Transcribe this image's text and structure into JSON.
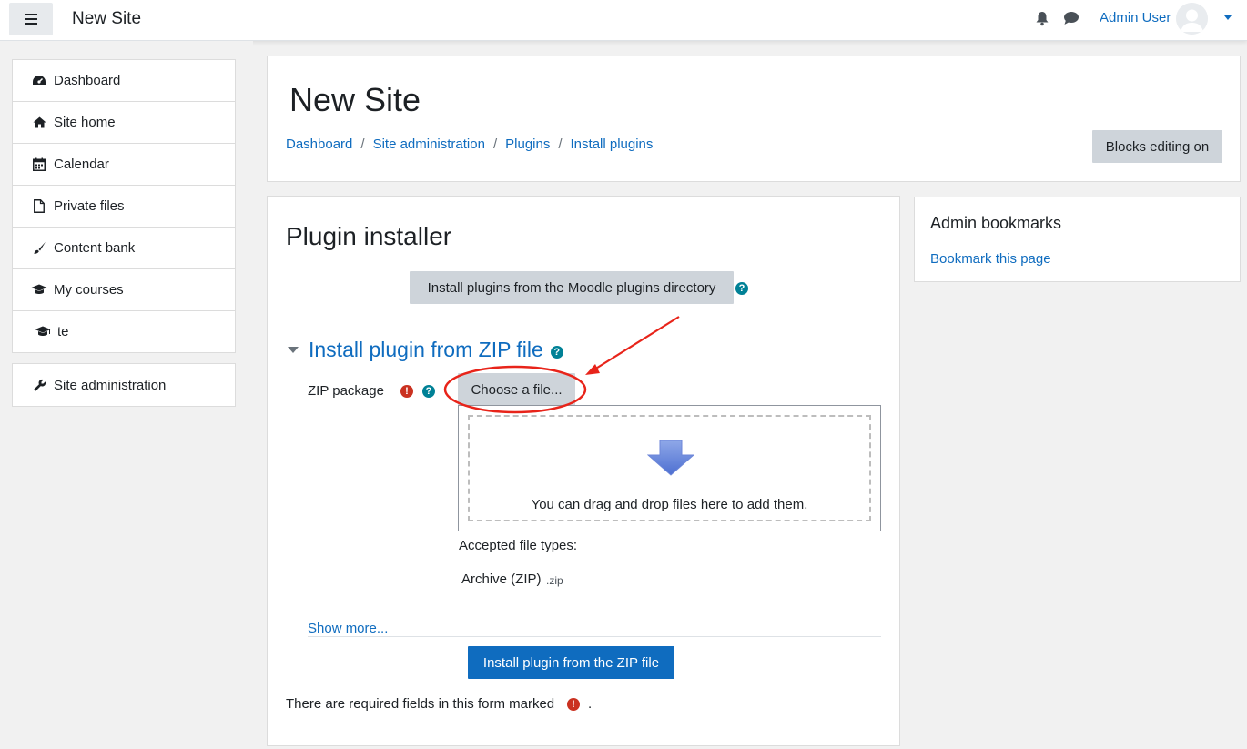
{
  "navbar": {
    "brand": "New Site",
    "user_name": "Admin User",
    "icons": [
      "menu-icon",
      "bell-icon",
      "chat-icon",
      "avatar",
      "chevron-down-icon"
    ]
  },
  "sidebar": {
    "items": [
      {
        "label": "Dashboard",
        "icon": "dashboard-icon"
      },
      {
        "label": "Site home",
        "icon": "home-icon"
      },
      {
        "label": "Calendar",
        "icon": "calendar-icon"
      },
      {
        "label": "Private files",
        "icon": "file-icon"
      },
      {
        "label": "Content bank",
        "icon": "paint-brush-icon"
      },
      {
        "label": "My courses",
        "icon": "graduation-cap-icon"
      },
      {
        "label": "te",
        "icon": "graduation-cap-icon"
      }
    ],
    "admin_item": {
      "label": "Site administration",
      "icon": "wrench-icon"
    }
  },
  "header": {
    "title": "New Site",
    "breadcrumb": [
      "Dashboard",
      "Site administration",
      "Plugins",
      "Install plugins"
    ],
    "breadcrumb_separator": "/",
    "blocks_editing_button": "Blocks editing on"
  },
  "main": {
    "heading": "Plugin installer",
    "directory_button": "Install plugins from the Moodle plugins directory",
    "section_title": "Install plugin from ZIP file",
    "zip_label": "ZIP package",
    "choose_file_button": "Choose a file...",
    "dropzone_text": "You can drag and drop files here to add them.",
    "accepted_label": "Accepted file types:",
    "accepted_type": "Archive (ZIP)",
    "accepted_ext": ".zip",
    "show_more": "Show more...",
    "submit_button": "Install plugin from the ZIP file",
    "required_note": "There are required fields in this form marked",
    "required_note_end": "."
  },
  "bookmarks": {
    "title": "Admin bookmarks",
    "link": "Bookmark this page"
  },
  "colors": {
    "accent": "#0f6cbf",
    "button_grey": "#ced4da",
    "help_icon": "#008196",
    "required_icon": "#ca3120",
    "annotation_red": "#e8241a"
  }
}
